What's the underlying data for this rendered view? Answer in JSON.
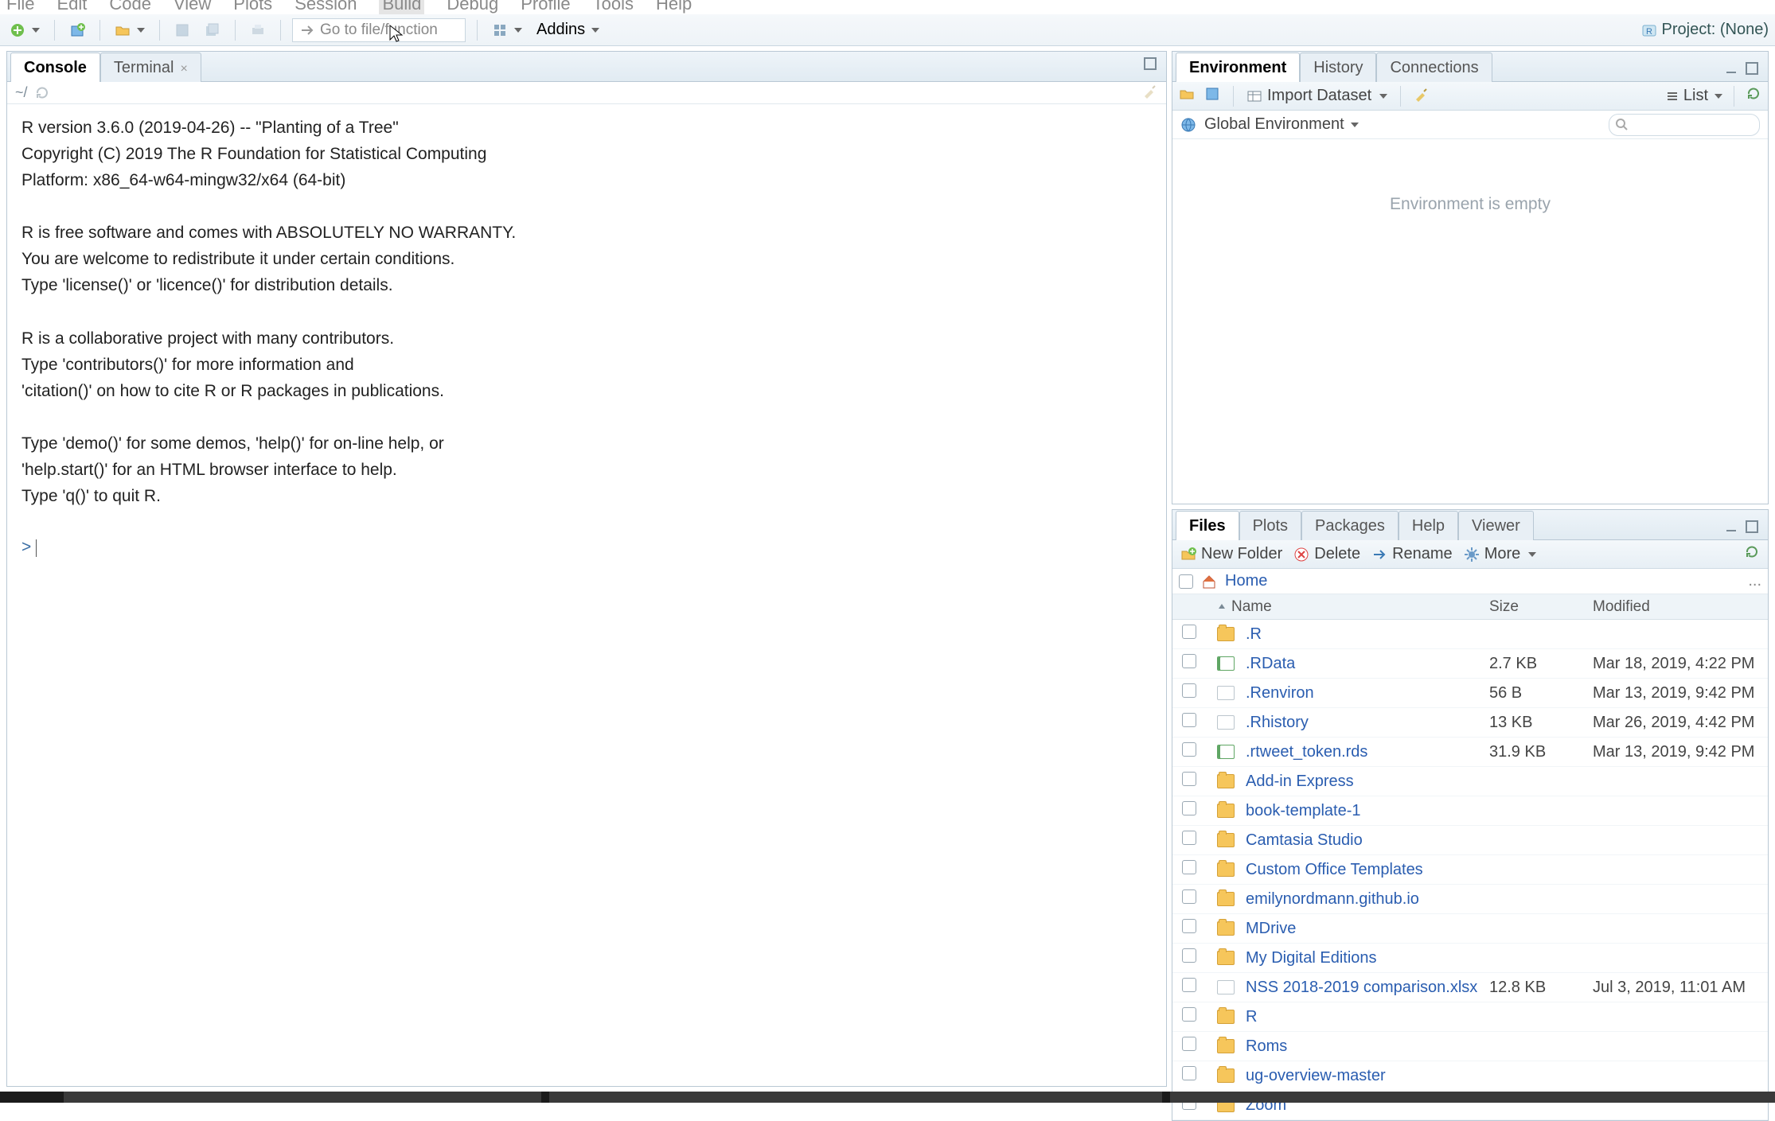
{
  "menu": [
    "File",
    "Edit",
    "Code",
    "View",
    "Plots",
    "Session",
    "Build",
    "Debug",
    "Profile",
    "Tools",
    "Help"
  ],
  "menu_highlight": "Build",
  "toolbar": {
    "gotofile_placeholder": "Go to file/function",
    "addins_label": "Addins",
    "project_label": "Project: (None)"
  },
  "left": {
    "tabs": {
      "console": "Console",
      "terminal": "Terminal"
    },
    "path": "~/",
    "console_text": "R version 3.6.0 (2019-04-26) -- \"Planting of a Tree\"\nCopyright (C) 2019 The R Foundation for Statistical Computing\nPlatform: x86_64-w64-mingw32/x64 (64-bit)\n\nR is free software and comes with ABSOLUTELY NO WARRANTY.\nYou are welcome to redistribute it under certain conditions.\nType 'license()' or 'licence()' for distribution details.\n\nR is a collaborative project with many contributors.\nType 'contributors()' for more information and\n'citation()' on how to cite R or R packages in publications.\n\nType 'demo()' for some demos, 'help()' for on-line help, or\n'help.start()' for an HTML browser interface to help.\nType 'q()' to quit R.\n",
    "prompt": "> "
  },
  "env": {
    "tabs": [
      "Environment",
      "History",
      "Connections"
    ],
    "import_label": "Import Dataset",
    "list_label": "List",
    "scope_label": "Global Environment",
    "empty_text": "Environment is empty"
  },
  "files": {
    "tabs": [
      "Files",
      "Plots",
      "Packages",
      "Help",
      "Viewer"
    ],
    "toolbar": {
      "new_folder": "New Folder",
      "delete": "Delete",
      "rename": "Rename",
      "more": "More"
    },
    "breadcrumb_home": "Home",
    "headers": {
      "name": "Name",
      "size": "Size",
      "modified": "Modified"
    },
    "rows": [
      {
        "icon": "folder",
        "name": ".R",
        "size": "",
        "mod": ""
      },
      {
        "icon": "filegreen",
        "name": ".RData",
        "size": "2.7 KB",
        "mod": "Mar 18, 2019, 4:22 PM"
      },
      {
        "icon": "filedoc",
        "name": ".Renviron",
        "size": "56 B",
        "mod": "Mar 13, 2019, 9:42 PM"
      },
      {
        "icon": "filedoc",
        "name": ".Rhistory",
        "size": "13 KB",
        "mod": "Mar 26, 2019, 4:42 PM"
      },
      {
        "icon": "filegreen",
        "name": ".rtweet_token.rds",
        "size": "31.9 KB",
        "mod": "Mar 13, 2019, 9:42 PM"
      },
      {
        "icon": "folder",
        "name": "Add-in Express",
        "size": "",
        "mod": ""
      },
      {
        "icon": "folder",
        "name": "book-template-1",
        "size": "",
        "mod": ""
      },
      {
        "icon": "folder",
        "name": "Camtasia Studio",
        "size": "",
        "mod": ""
      },
      {
        "icon": "folder",
        "name": "Custom Office Templates",
        "size": "",
        "mod": ""
      },
      {
        "icon": "folder",
        "name": "emilynordmann.github.io",
        "size": "",
        "mod": ""
      },
      {
        "icon": "folder",
        "name": "MDrive",
        "size": "",
        "mod": ""
      },
      {
        "icon": "folder",
        "name": "My Digital Editions",
        "size": "",
        "mod": ""
      },
      {
        "icon": "filedoc",
        "name": "NSS 2018-2019 comparison.xlsx",
        "size": "12.8 KB",
        "mod": "Jul 3, 2019, 11:01 AM"
      },
      {
        "icon": "folder",
        "name": "R",
        "size": "",
        "mod": ""
      },
      {
        "icon": "folder",
        "name": "Roms",
        "size": "",
        "mod": ""
      },
      {
        "icon": "folder",
        "name": "ug-overview-master",
        "size": "",
        "mod": ""
      },
      {
        "icon": "folder",
        "name": "Zoom",
        "size": "",
        "mod": ""
      }
    ]
  }
}
